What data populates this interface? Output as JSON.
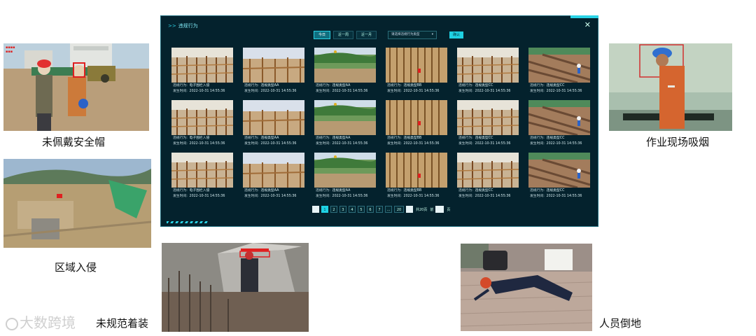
{
  "captions": {
    "no_helmet": "未佩戴安全帽",
    "zone_intrusion": "区域入侵",
    "improper_attire": "未规范着装",
    "smoking": "作业现场吸烟",
    "fall": "人员倒地"
  },
  "watermark": "大数跨境",
  "dashboard": {
    "title": "违规行为",
    "close_icon": "close-icon",
    "tabs": [
      {
        "label": "今日",
        "active": true
      },
      {
        "label": "近一周",
        "active": false
      },
      {
        "label": "近一月",
        "active": false
      }
    ],
    "select": {
      "value": "请选择违规行为类型",
      "icon": "chevron-down-icon"
    },
    "confirm_label": "确认",
    "meta_labels": {
      "behavior": "违规行为:",
      "time": "发生时间:"
    },
    "cards": [
      {
        "behavior": "电子围栏入侵",
        "time": "2022-10-31 14:55:36",
        "scene": "a"
      },
      {
        "behavior": "违规类型AA",
        "time": "2022-10-31 14:55:36",
        "scene": "b"
      },
      {
        "behavior": "违规类型AA",
        "time": "2022-10-31 14:55:36",
        "scene": "c"
      },
      {
        "behavior": "违规类型BB",
        "time": "2022-10-31 14:55:36",
        "scene": "d"
      },
      {
        "behavior": "违规类型CC",
        "time": "2022-10-31 14:55:36",
        "scene": "a"
      },
      {
        "behavior": "违规类型CC",
        "time": "2022-10-31 14:55:36",
        "scene": "e"
      },
      {
        "behavior": "电子围栏入侵",
        "time": "2022-10-31 14:55:36",
        "scene": "a"
      },
      {
        "behavior": "违规类型AA",
        "time": "2022-10-31 14:55:36",
        "scene": "b"
      },
      {
        "behavior": "违规类型AA",
        "time": "2022-10-31 14:55:36",
        "scene": "c"
      },
      {
        "behavior": "违规类型BB",
        "time": "2022-10-31 14:55:36",
        "scene": "d"
      },
      {
        "behavior": "违规类型CC",
        "time": "2022-10-31 14:55:36",
        "scene": "a"
      },
      {
        "behavior": "违规类型CC",
        "time": "2022-10-31 14:55:36",
        "scene": "e"
      },
      {
        "behavior": "电子围栏入侵",
        "time": "2022-10-31 14:55:36",
        "scene": "a"
      },
      {
        "behavior": "违规类型AA",
        "time": "2022-10-31 14:55:36",
        "scene": "b"
      },
      {
        "behavior": "违规类型AA",
        "time": "2022-10-31 14:55:36",
        "scene": "c"
      },
      {
        "behavior": "违规类型BB",
        "time": "2022-10-31 14:55:36",
        "scene": "d"
      },
      {
        "behavior": "违规类型CC",
        "time": "2022-10-31 14:55:36",
        "scene": "a"
      },
      {
        "behavior": "违规类型CC",
        "time": "2022-10-31 14:55:36",
        "scene": "e"
      }
    ],
    "pagination": {
      "prev_icon": "chevron-left-icon",
      "pages": [
        "1",
        "2",
        "3",
        "4",
        "5",
        "6",
        "7",
        "...",
        "20"
      ],
      "active": "1",
      "next_icon": "chevron-right-icon",
      "total_prefix": "共20页",
      "goto_prefix": "前",
      "goto_suffix": "页"
    }
  },
  "colors": {
    "panel_bg": "#04222d",
    "accent": "#2ad3e6",
    "box_red": "#e02020"
  }
}
